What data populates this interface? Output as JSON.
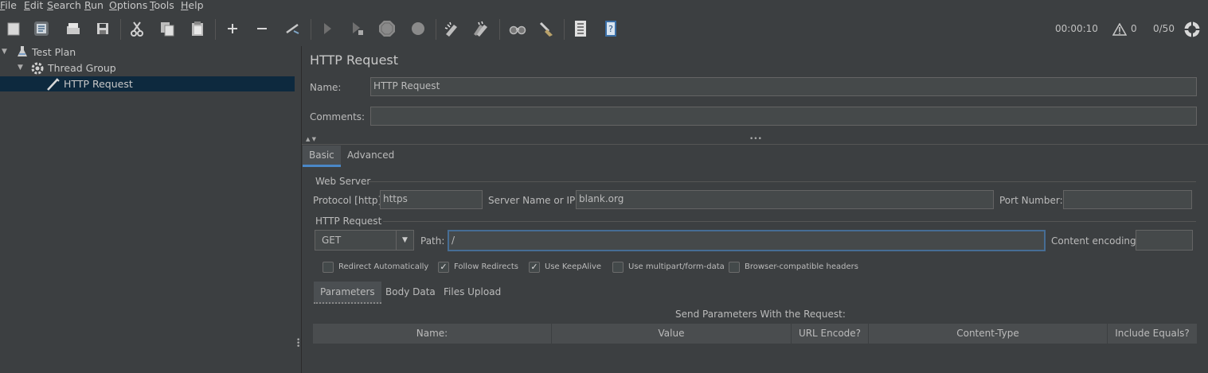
{
  "menu": [
    "File",
    "Edit",
    "Search",
    "Run",
    "Options",
    "Tools",
    "Help"
  ],
  "menu_mnemonics": [
    "F",
    "E",
    "S",
    "R",
    "O",
    "T",
    "H"
  ],
  "toolbar": {
    "icons": [
      "new-icon",
      "templates-icon",
      "open-icon",
      "save-icon",
      "cut-icon",
      "copy-icon",
      "paste-icon",
      "expand-icon",
      "collapse-icon",
      "toggle-icon",
      "start-icon",
      "start-no-pause-icon",
      "stop-icon",
      "shutdown-icon",
      "clear-icon",
      "clear-all-icon",
      "search-icon",
      "reset-search-icon",
      "function-helper-icon",
      "help-icon"
    ],
    "timer": "00:00:10",
    "warnings": "0",
    "threads": "0/50"
  },
  "tree": {
    "items": [
      {
        "label": "Test Plan",
        "icon": "test-plan-icon"
      },
      {
        "label": "Thread Group",
        "icon": "thread-group-icon"
      },
      {
        "label": "HTTP Request",
        "icon": "http-request-icon"
      }
    ]
  },
  "panel": {
    "title": "HTTP Request",
    "name_label": "Name:",
    "name_value": "HTTP Request",
    "comments_label": "Comments:",
    "comments_value": "",
    "tabs": [
      "Basic",
      "Advanced"
    ],
    "web_server": {
      "legend": "Web Server",
      "protocol_label": "Protocol [http]:",
      "protocol_value": "https",
      "server_label": "Server Name or IP:",
      "server_value": "blank.org",
      "port_label": "Port Number:",
      "port_value": ""
    },
    "http_request": {
      "legend": "HTTP Request",
      "method": "GET",
      "path_label": "Path:",
      "path_value": "/",
      "encoding_label": "Content encoding:",
      "encoding_value": ""
    },
    "checkboxes": [
      {
        "label": "Redirect Automatically",
        "checked": false
      },
      {
        "label": "Follow Redirects",
        "checked": true
      },
      {
        "label": "Use KeepAlive",
        "checked": true
      },
      {
        "label": "Use multipart/form-data",
        "checked": false
      },
      {
        "label": "Browser-compatible headers",
        "checked": false
      }
    ],
    "subtabs": [
      "Parameters",
      "Body Data",
      "Files Upload"
    ],
    "table_caption": "Send Parameters With the Request:",
    "columns": [
      "Name:",
      "Value",
      "URL Encode?",
      "Content-Type",
      "Include Equals?"
    ]
  }
}
